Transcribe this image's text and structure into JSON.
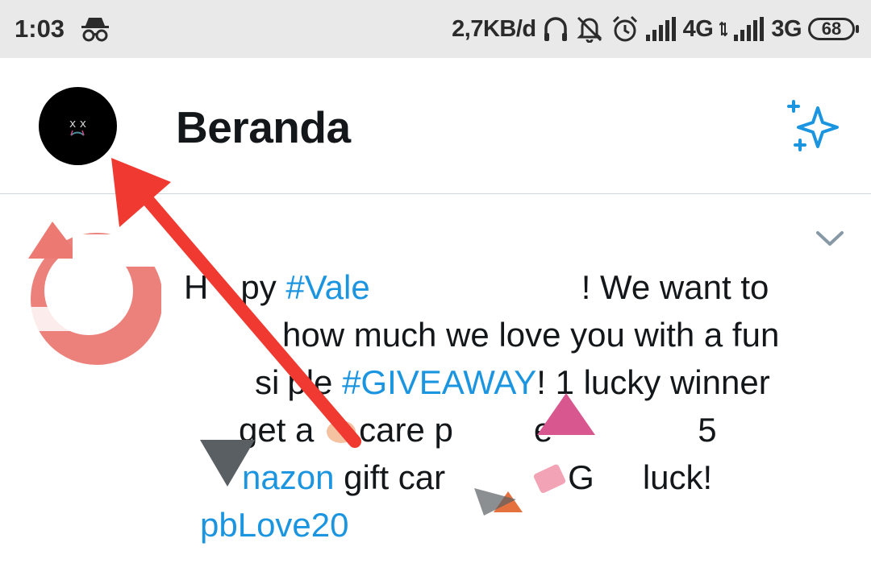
{
  "status_bar": {
    "time": "1:03",
    "net_speed": "2,7KB/d",
    "net1": "4G",
    "net2": "3G",
    "battery": "68",
    "icons": [
      "incognito-icon",
      "headphones-icon",
      "mute-icon",
      "alarm-icon",
      "signal-icon",
      "signal-icon-2"
    ]
  },
  "header": {
    "title": "Beranda",
    "avatar_icon": "profile-avatar",
    "action_icon": "sparkle-icon"
  },
  "tweet": {
    "line1_a": "H",
    "line1_b": "py ",
    "line1_tag": "#Vale",
    "line1_c": "! We want to",
    "line2": "how much we love you with a fun",
    "line3_a": "si",
    "line3_b": "ple ",
    "line3_tag": "#GIVEAWAY",
    "line3_c": "! 1 lucky winner",
    "line4_a": "get a ",
    "line4_b": "care p",
    "line4_c": "e",
    "line4_d": "5",
    "line5_tag": "nazon",
    "line5_a": " gift car",
    "line5_b": "G",
    "line5_c": "luck!",
    "line6_tag": "pbLove20"
  },
  "colors": {
    "accent": "#1b95e0",
    "arrow": "#f03a31",
    "statusbar_bg": "#e9e9e9"
  }
}
